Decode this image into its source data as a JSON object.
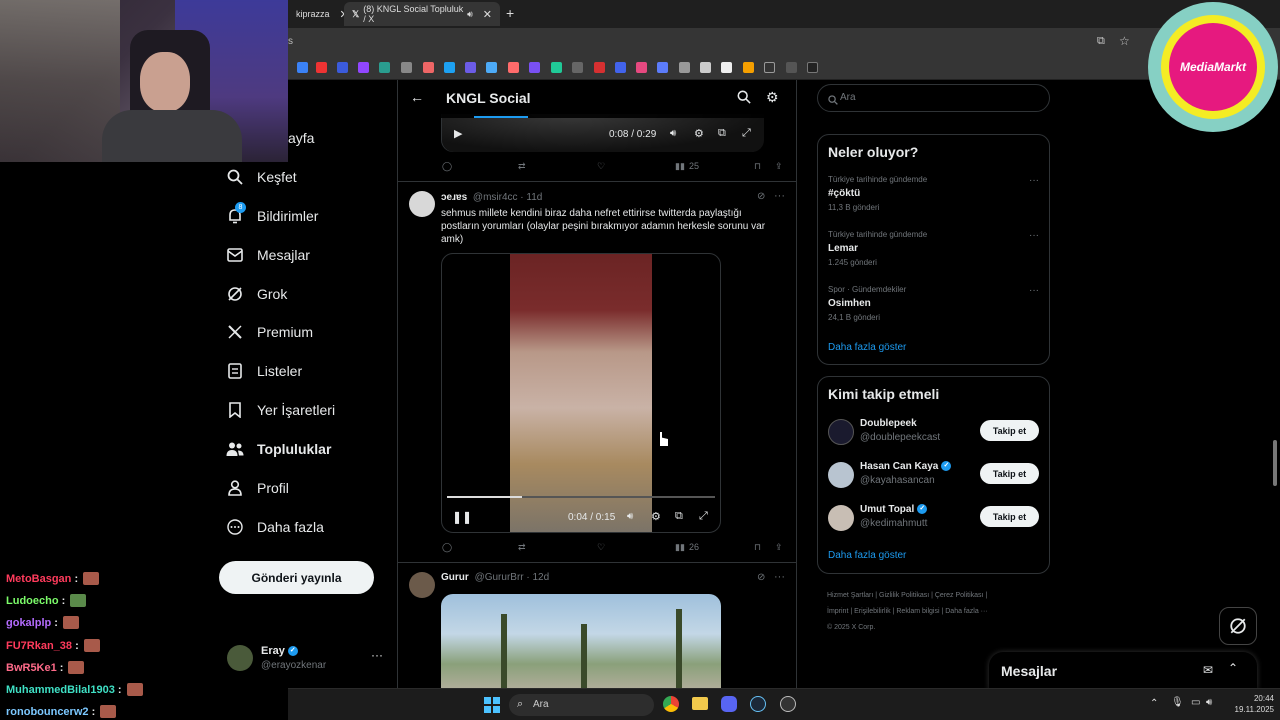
{
  "browser": {
    "tab1_title": "kiprazza",
    "tab2_title": "(8) KNGL Social Topluluk / X",
    "address_value": "s"
  },
  "header": {
    "title": "KNGL Social"
  },
  "nav": {
    "items": [
      {
        "label": "ayfa",
        "icon": "home-icon"
      },
      {
        "label": "Keşfet",
        "icon": "search-icon"
      },
      {
        "label": "Bildirimler",
        "icon": "bell-icon"
      },
      {
        "label": "Mesajlar",
        "icon": "mail-icon"
      },
      {
        "label": "Grok",
        "icon": "grok-icon"
      },
      {
        "label": "Premium",
        "icon": "x-logo-icon"
      },
      {
        "label": "Listeler",
        "icon": "list-icon"
      },
      {
        "label": "Yer İşaretleri",
        "icon": "bookmark-icon"
      },
      {
        "label": "Topluluklar",
        "icon": "communities-icon"
      },
      {
        "label": "Profil",
        "icon": "profile-icon"
      },
      {
        "label": "Daha fazla",
        "icon": "more-icon"
      }
    ],
    "notification_badge": "8",
    "post_button": "Gönderi yayınla",
    "account_name": "Eray",
    "account_handle": "@erayozkenar"
  },
  "feed": {
    "video1_time": "0:08 / 0:29",
    "post1_views": "25",
    "post2": {
      "author": "ɔeɹɐs",
      "handle_time": "@msir4cc · 11d",
      "text": "sehmus millete kendini biraz daha nefret ettirirse twitterda paylaştığı postların yorumları (olaylar peşini bırakmıyor adamın herkesle sorunu var amk)",
      "video_time": "0:04 / 0:15",
      "views": "26"
    },
    "post3": {
      "author": "Gurur",
      "handle_time": "@GururBrr · 12d"
    }
  },
  "right": {
    "search_placeholder": "Ara",
    "trends_title": "Neler oluyor?",
    "trends": [
      {
        "meta": "Türkiye tarihinde gündemde",
        "name": "#çöktü",
        "count": "11,3 B gönderi"
      },
      {
        "meta": "Türkiye tarihinde gündemde",
        "name": "Lemar",
        "count": "1.245 gönderi"
      },
      {
        "meta": "Spor · Gündemdekiler",
        "name": "Osimhen",
        "count": "24,1 B gönderi"
      }
    ],
    "show_more": "Daha fazla göster",
    "who_title": "Kimi takip etmeli",
    "who": [
      {
        "name": "Doublepeek",
        "handle": "@doublepeekcast"
      },
      {
        "name": "Hasan Can Kaya",
        "handle": "@kayahasancan"
      },
      {
        "name": "Umut Topal",
        "handle": "@kedimahmutt"
      }
    ],
    "follow_label": "Takip et",
    "footer1": "Hizmet Şartları  |  Gizlilik Politikası  |  Çerez Politikası  |",
    "footer2": "İmprint  |  Erişilebilirlik  |  Reklam bilgisi  |  Daha fazla ···",
    "footer3": "© 2025 X Corp.",
    "messages_label": "Mesajlar"
  },
  "chat": [
    {
      "user": "MetoBasgan",
      "color": "#ff3b5c"
    },
    {
      "user": "Ludoecho",
      "color": "#7cfc6a"
    },
    {
      "user": "gokalplp",
      "color": "#b46bff"
    },
    {
      "user": "FU7Rkan_38",
      "color": "#ff3b5c"
    },
    {
      "user": "BwR5Ke1",
      "color": "#ff6b8a"
    },
    {
      "user": "MuhammedBilal1903",
      "color": "#3fe0c5"
    },
    {
      "user": "ronobouncerw2",
      "color": "#7cc8ff"
    }
  ],
  "mm_logo": "MediaMarkt",
  "taskbar": {
    "search": "Ara",
    "time": "20:44",
    "date": "19.11.2025"
  }
}
